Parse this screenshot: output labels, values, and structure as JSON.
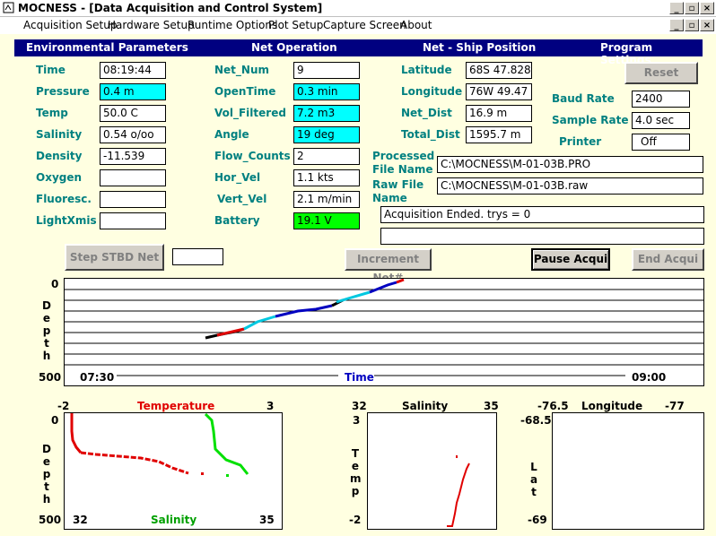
{
  "window": {
    "title": "MOCNESS - [Data Acquisition and Control System]"
  },
  "menu": [
    "Acquisition Setup",
    "Hardware Setup",
    "Runtime Options",
    "Plot Setup",
    "Capture Screen",
    "About"
  ],
  "headers": {
    "env": "Environmental Parameters",
    "net": "Net Operation",
    "pos": "Net - Ship Position",
    "prog": "Program Settings"
  },
  "env": {
    "time": {
      "label": "Time",
      "value": "08:19:44"
    },
    "pressure": {
      "label": "Pressure",
      "value": "0.4 m"
    },
    "temp": {
      "label": "Temp",
      "value": "50.0 C"
    },
    "salinity": {
      "label": "Salinity",
      "value": "0.54 o/oo"
    },
    "density": {
      "label": "Density",
      "value": "-11.539"
    },
    "oxygen": {
      "label": "Oxygen",
      "value": ""
    },
    "fluoresc": {
      "label": "Fluoresc.",
      "value": ""
    },
    "lightxmis": {
      "label": "LightXmis",
      "value": ""
    }
  },
  "net": {
    "net_num": {
      "label": "Net_Num",
      "value": "9"
    },
    "opentime": {
      "label": "OpenTime",
      "value": "0.3 min"
    },
    "vol_filtered": {
      "label": "Vol_Filtered",
      "value": "7.2 m3"
    },
    "angle": {
      "label": "Angle",
      "value": "19 deg"
    },
    "flow_counts": {
      "label": "Flow_Counts",
      "value": "2"
    },
    "hor_vel": {
      "label": "Hor_Vel",
      "value": "1.1 kts"
    },
    "vert_vel": {
      "label": "Vert_Vel",
      "value": "2.1 m/min"
    },
    "battery": {
      "label": "Battery",
      "value": "19.1 V"
    }
  },
  "pos": {
    "latitude": {
      "label": "Latitude",
      "value": "68S 47.828"
    },
    "longitude": {
      "label": "Longitude",
      "value": "76W 49.47"
    },
    "net_dist": {
      "label": "Net_Dist",
      "value": "16.9 m"
    },
    "total_dist": {
      "label": "Total_Dist",
      "value": "1595.7 m"
    }
  },
  "prog": {
    "reset": "Reset",
    "baud_rate": {
      "label": "Baud Rate",
      "value": "2400"
    },
    "sample_rate": {
      "label": "Sample Rate",
      "value": "4.0 sec"
    },
    "printer": {
      "label": "Printer",
      "value": "Off"
    }
  },
  "files": {
    "processed_label_1": "Processed",
    "processed_label_2": "File Name",
    "processed_value": "C:\\MOCNESS\\M-01-03B.PRO",
    "raw_label_1": "Raw File",
    "raw_label_2": "Name",
    "raw_value": "C:\\MOCNESS\\M-01-03B.raw",
    "status": "Acquisition Ended.  trys = 0",
    "status2": ""
  },
  "buttons": {
    "step": "Step STBD Net",
    "step_value": "",
    "increment": "Increment Net#",
    "pause": "Pause Acqui",
    "end": "End Acqui"
  },
  "depth_plot": {
    "ytop": "0",
    "ybottom": "500",
    "ylabel": "Depth",
    "xstart": "07:30",
    "xend": "09:00",
    "xlabel": "Time"
  },
  "ts_plot": {
    "xmin": "-2",
    "xmax": "3",
    "title": "Temperature",
    "ytop": "0",
    "ybottom": "500",
    "ylabel": "Depth",
    "smin": "32",
    "smax": "35",
    "sal_label": "Salinity"
  },
  "st_plot": {
    "xmin": "32",
    "xmax": "35",
    "title": "Salinity",
    "ytop": "3",
    "ybottom": "-2",
    "ylabel": "Temp"
  },
  "ll_plot": {
    "xmin": "-76.5",
    "xmax": "-77",
    "title": "Longitude",
    "ytop": "-68.5",
    "ybottom": "-69",
    "ylabel": "Lat"
  },
  "colors": {
    "header": "#000080",
    "label": "#008080",
    "cyan": "#00ffff",
    "green": "#00ff00",
    "temp": "#e00000",
    "salinity": "#00c000",
    "time_label": "#0000c0"
  }
}
